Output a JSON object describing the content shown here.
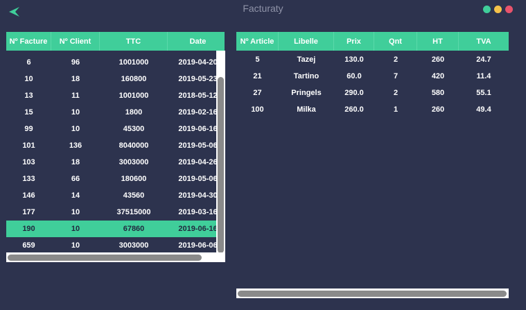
{
  "window": {
    "title": "Facturaty"
  },
  "colors": {
    "background": "#2d334e",
    "accent": "#40ce9a",
    "dot_green": "#40ce9a",
    "dot_yellow": "#f5c24a",
    "dot_red": "#e8536c"
  },
  "left_table": {
    "headers": [
      "Nº Facture",
      "Nº Client",
      "TTC",
      "Date"
    ],
    "rows": [
      [
        "6",
        "96",
        "1001000",
        "2019-04-20"
      ],
      [
        "10",
        "18",
        "160800",
        "2019-05-23"
      ],
      [
        "13",
        "11",
        "1001000",
        "2018-05-12"
      ],
      [
        "15",
        "10",
        "1800",
        "2019-02-16"
      ],
      [
        "99",
        "10",
        "45300",
        "2019-06-16"
      ],
      [
        "101",
        "136",
        "8040000",
        "2019-05-06"
      ],
      [
        "103",
        "18",
        "3003000",
        "2019-04-26"
      ],
      [
        "133",
        "66",
        "180600",
        "2019-05-06"
      ],
      [
        "146",
        "14",
        "43560",
        "2019-04-30"
      ],
      [
        "177",
        "10",
        "37515000",
        "2019-03-16"
      ],
      [
        "190",
        "10",
        "67860",
        "2019-06-16"
      ],
      [
        "659",
        "10",
        "3003000",
        "2019-06-06"
      ]
    ],
    "selected_index": 10
  },
  "right_table": {
    "headers": [
      "Nº Article",
      "Libelle",
      "Prix",
      "Qnt",
      "HT",
      "TVA"
    ],
    "rows": [
      [
        "5",
        "Tazej",
        "130.0",
        "2",
        "260",
        "24.7"
      ],
      [
        "21",
        "Tartino",
        "60.0",
        "7",
        "420",
        "11.4"
      ],
      [
        "27",
        "Pringels",
        "290.0",
        "2",
        "580",
        "55.1"
      ],
      [
        "100",
        "Milka",
        "260.0",
        "1",
        "260",
        "49.4"
      ]
    ]
  }
}
